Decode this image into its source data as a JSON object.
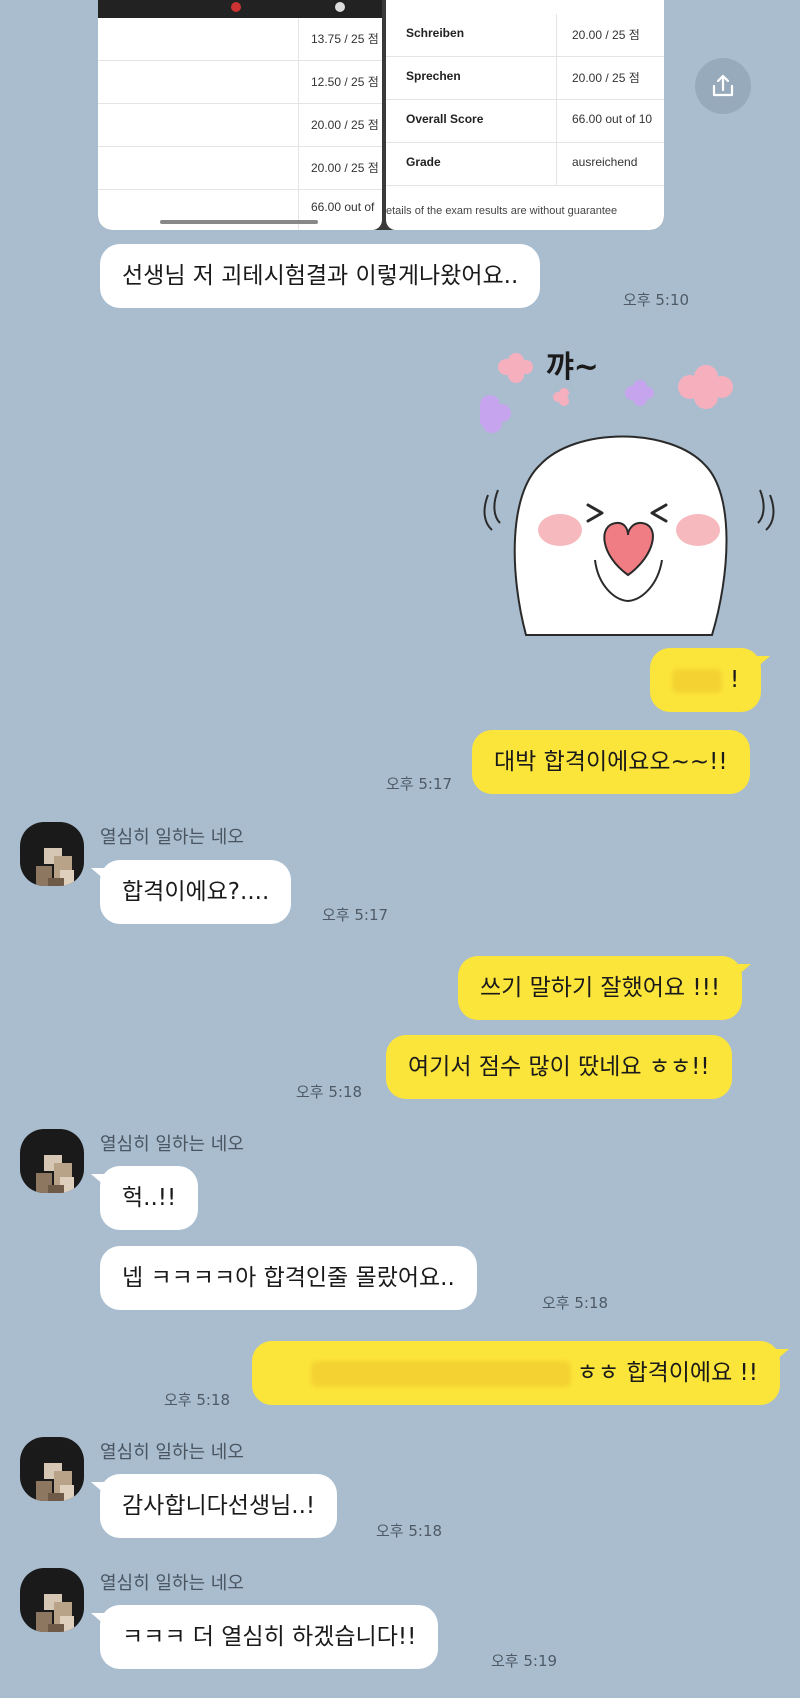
{
  "shared_image": {
    "left_rows": [
      {
        "value": "13.75 / 25 점"
      },
      {
        "value": "12.50 / 25 점"
      },
      {
        "value": "20.00 / 25 점"
      },
      {
        "value": "20.00 / 25 점"
      },
      {
        "value": "66.00 out of"
      }
    ],
    "right_rows": [
      {
        "label": "Schreiben",
        "value": "20.00 / 25 점"
      },
      {
        "label": "Sprechen",
        "value": "20.00 / 25 점"
      },
      {
        "label": "Overall Score",
        "value": "66.00 out of 10"
      },
      {
        "label": "Grade",
        "value": "ausreichend"
      }
    ],
    "footer": "etails of the exam results are without guarantee"
  },
  "share_button_icon": "share-icon",
  "messages": [
    {
      "text": "선생님 저 괴테시험결과 이렇게나왔어요..",
      "time": "오후 5:10"
    },
    {
      "sticker_text": "꺄~"
    },
    {
      "text": "!"
    },
    {
      "text": "대박 합격이에요오~~!!",
      "time": "오후 5:17"
    },
    {
      "sender": "열심히 일하는 네오",
      "text": "합격이에요?....",
      "time": "오후 5:17"
    },
    {
      "text": "쓰기 말하기 잘했어요 !!!"
    },
    {
      "text": "여기서 점수 많이 땄네요 ㅎㅎ!!",
      "time": "오후 5:18"
    },
    {
      "sender": "열심히 일하는 네오",
      "text": "헉..!!"
    },
    {
      "text": "넵 ㅋㅋㅋㅋ아 합격인줄 몰랐어요..",
      "time": "오후 5:18"
    },
    {
      "text": "ㅎㅎ 합격이에요 !!",
      "time": "오후 5:18"
    },
    {
      "sender": "열심히 일하는 네오",
      "text": "감사합니다선생님..!",
      "time": "오후 5:18"
    },
    {
      "sender": "열심히 일하는 네오",
      "text": "ㅋㅋㅋ 더 열심히 하겠습니다!!",
      "time": "오후 5:19"
    }
  ],
  "colors": {
    "background": "#a9bdce",
    "incoming_bubble": "#ffffff",
    "outgoing_bubble": "#fce53a"
  }
}
